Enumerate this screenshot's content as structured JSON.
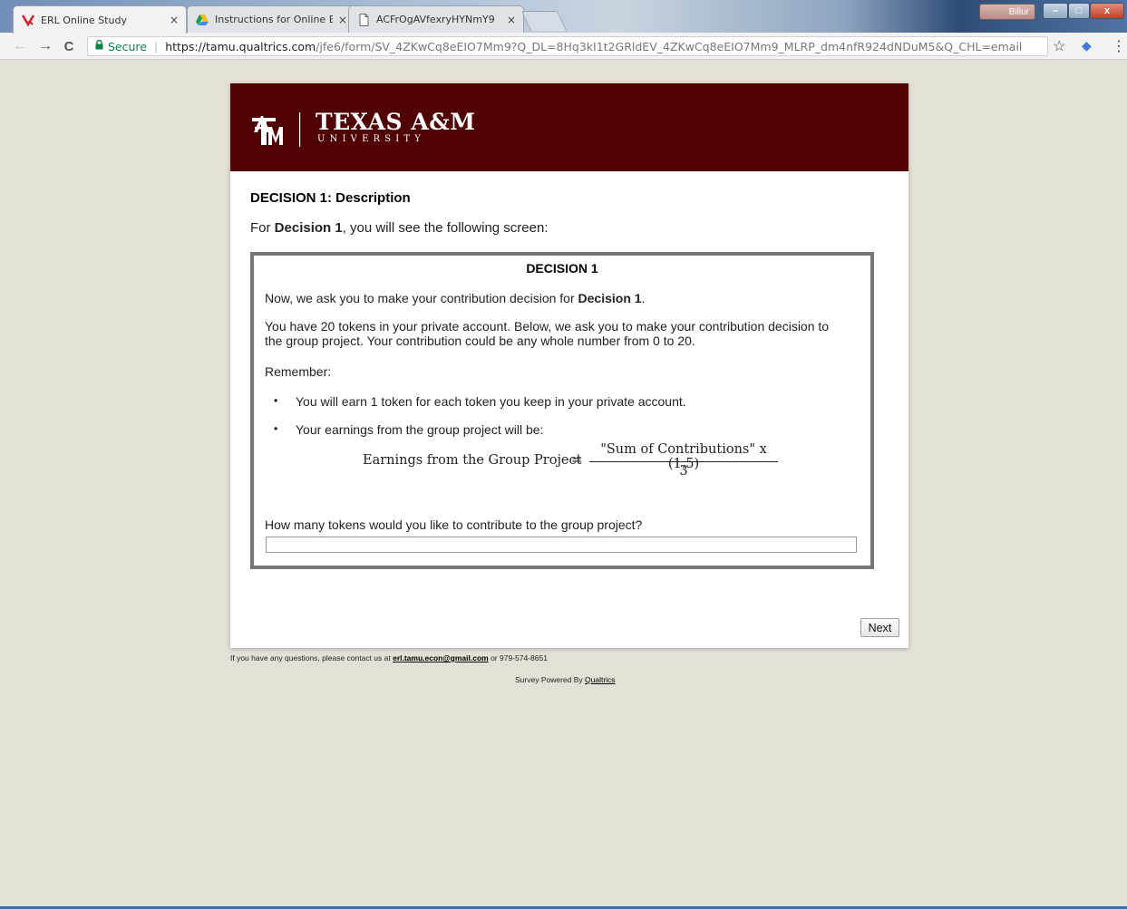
{
  "browser": {
    "tabs": [
      {
        "title": "ERL Online Study",
        "close": "×"
      },
      {
        "title": "Instructions for Online E",
        "close": "×"
      },
      {
        "title": "ACFrOgAVfexryHYNmY9",
        "close": "×"
      }
    ],
    "user_label": "Billur",
    "window_controls": {
      "minimize": "–",
      "maximize": "□",
      "close": "x"
    },
    "address": {
      "secure_label": "Secure",
      "separator": "|",
      "host": "https://tamu.qualtrics.com",
      "path": "/jfe6/form/SV_4ZKwCq8eEIO7Mm9?Q_DL=8Hq3kI1t2GRldEV_4ZKwCq8eEIO7Mm9_MLRP_dm4nfR924dNDuM5&Q_CHL=email"
    },
    "nav": {
      "back": "←",
      "forward": "→",
      "reload": "C"
    },
    "toolbar_icons": {
      "star": "☆",
      "extension": "◆",
      "menu": "⋮"
    }
  },
  "banner": {
    "brand_name": "TEXAS A&M",
    "brand_sub": "U N I V E R S I T Y",
    "color": "#500000"
  },
  "survey": {
    "heading": "DECISION 1: Description",
    "intro_prefix": "For ",
    "intro_bold": "Decision 1",
    "intro_suffix": ", you will see the following screen:",
    "decision_box": {
      "title": "DECISION 1",
      "line1_prefix": "Now, we ask you to make your contribution decision for ",
      "line1_bold": "Decision 1",
      "line1_suffix": ".",
      "paragraph_line1": "You have 20 tokens in your private account. Below, we ask you to make your contribution decision to",
      "paragraph_line2": "the group project. Your contribution could be any whole number from 0 to 20.",
      "remember": "Remember:",
      "bullet_dot": "•",
      "bullet1": "You will earn 1 token for each token you keep in your private account.",
      "bullet2": "Your earnings from the group project will be:",
      "formula": {
        "lhs": "Earnings from the Group Project",
        "eq": "=",
        "numerator": "\"Sum of Contributions\" x (1.5)",
        "denominator": "3"
      },
      "question": "How many tokens would you like to contribute to the group project?",
      "answer_value": ""
    },
    "next_label": "Next"
  },
  "footer": {
    "contact_prefix": "If you have any questions, please contact us at ",
    "email": "erl.tamu.econ@gmail.com",
    "contact_or": " or ",
    "phone": "979-574-8651",
    "powered_prefix": "Survey Powered By ",
    "powered_link": "Qualtrics"
  }
}
